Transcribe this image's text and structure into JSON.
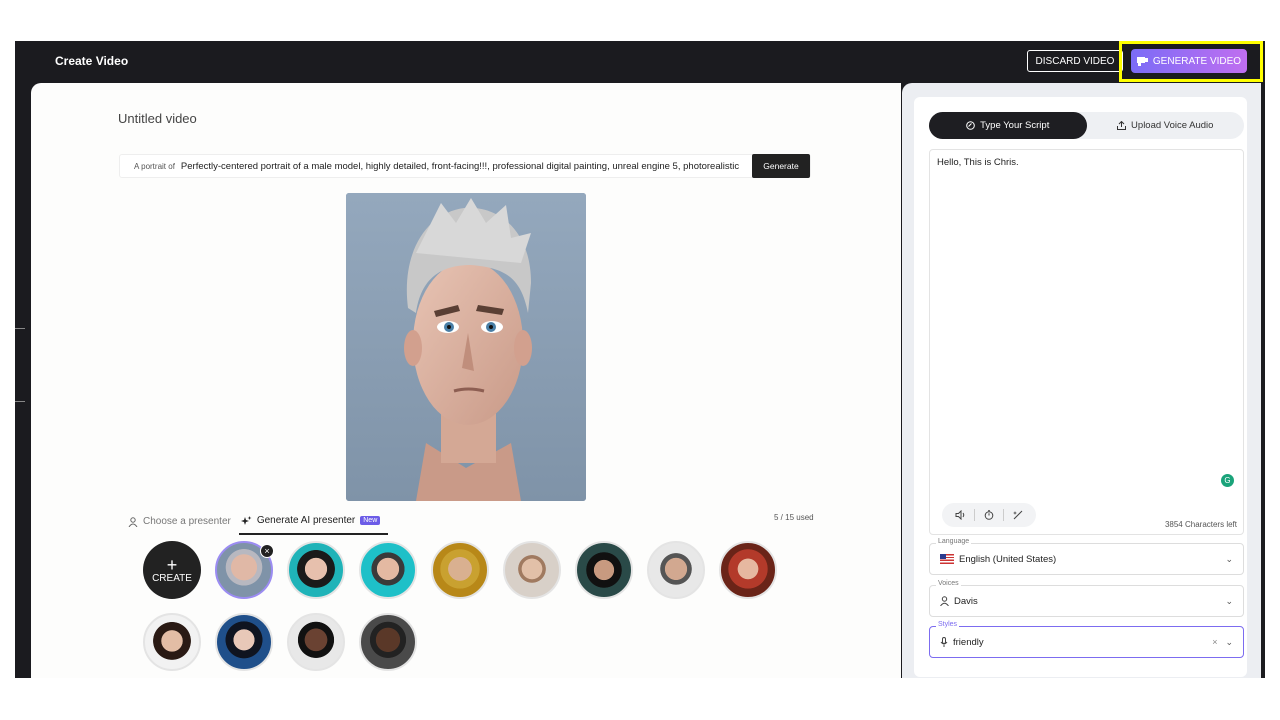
{
  "topbar": {
    "title": "Create Video",
    "discard_label": "DISCARD VIDEO",
    "generate_label": "GENERATE VIDEO"
  },
  "editor": {
    "video_title": "Untitled video",
    "prompt": {
      "label": "A portrait of",
      "value": "Perfectly-centered portrait of a male model, highly detailed, front-facing!!!, professional digital painting, unreal engine 5, photorealistic",
      "button": "Generate"
    },
    "tabs": [
      {
        "label": "Choose a presenter",
        "icon": "person-icon"
      },
      {
        "label": "Generate AI presenter",
        "icon": "sparkle-icon",
        "badge": "New"
      }
    ],
    "usage": "5 / 15 used",
    "create_label": "CREATE",
    "presenters_count": 12
  },
  "panel": {
    "tabs": [
      {
        "label": "Type Your Script",
        "icon": "script-icon"
      },
      {
        "label": "Upload Voice Audio",
        "icon": "upload-icon"
      }
    ],
    "script_text": "Hello, This is Chris.",
    "grammarly": "G",
    "chars_left": "3854 Characters left",
    "language": {
      "label": "Language",
      "value": "English (United States)"
    },
    "voices": {
      "label": "Voices",
      "value": "Davis"
    },
    "styles": {
      "label": "Styles",
      "value": "friendly",
      "clear": "×"
    }
  },
  "colors": {
    "accent": "#7b6cf6",
    "highlight_border": "#ffff00",
    "dark": "#1b1b1f"
  }
}
